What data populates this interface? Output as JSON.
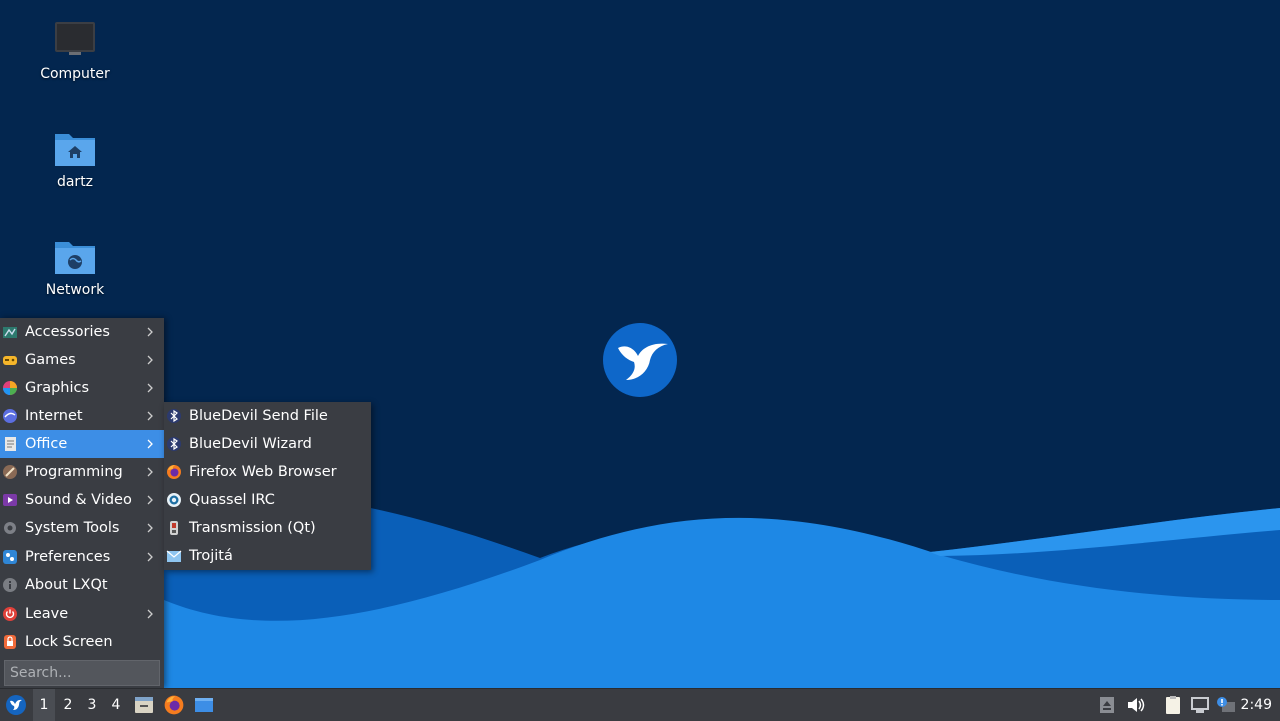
{
  "desktop": {
    "icons": [
      {
        "label": "Computer",
        "icon": "computer-icon"
      },
      {
        "label": "dartz",
        "icon": "home-folder-icon"
      },
      {
        "label": "Network",
        "icon": "network-folder-icon"
      }
    ],
    "wallpaper_colors": {
      "background": "#03264f",
      "wave_dark": "#0a5fb8",
      "wave_light": "#1e88e5"
    }
  },
  "main_menu": {
    "items": [
      {
        "label": "Accessories",
        "icon": "accessories-icon",
        "has_submenu": true
      },
      {
        "label": "Games",
        "icon": "games-icon",
        "has_submenu": true
      },
      {
        "label": "Graphics",
        "icon": "graphics-icon",
        "has_submenu": true
      },
      {
        "label": "Internet",
        "icon": "internet-icon",
        "has_submenu": true
      },
      {
        "label": "Office",
        "icon": "office-icon",
        "has_submenu": true,
        "active": true
      },
      {
        "label": "Programming",
        "icon": "programming-icon",
        "has_submenu": true
      },
      {
        "label": "Sound & Video",
        "icon": "sound-video-icon",
        "has_submenu": true
      },
      {
        "label": "System Tools",
        "icon": "system-tools-icon",
        "has_submenu": true
      },
      {
        "label": "Preferences",
        "icon": "preferences-icon",
        "has_submenu": true
      },
      {
        "label": "About LXQt",
        "icon": "info-icon",
        "has_submenu": false
      },
      {
        "label": "Leave",
        "icon": "power-icon",
        "has_submenu": true
      },
      {
        "label": "Lock Screen",
        "icon": "lock-icon",
        "has_submenu": false
      }
    ],
    "search_placeholder": "Search..."
  },
  "submenu": {
    "items": [
      {
        "label": "BlueDevil Send File",
        "icon": "bluetooth-icon"
      },
      {
        "label": "BlueDevil Wizard",
        "icon": "bluetooth-icon"
      },
      {
        "label": "Firefox Web Browser",
        "icon": "firefox-icon"
      },
      {
        "label": "Quassel IRC",
        "icon": "quassel-icon"
      },
      {
        "label": "Transmission (Qt)",
        "icon": "transmission-icon"
      },
      {
        "label": "Trojitá",
        "icon": "mail-icon"
      }
    ]
  },
  "taskbar": {
    "desktops": [
      "1",
      "2",
      "3",
      "4"
    ],
    "current_desktop": "1",
    "launchers": [
      "file-manager-icon",
      "firefox-icon",
      "show-desktop-icon"
    ],
    "tray": [
      "eject-icon",
      "volume-icon",
      "clipboard-icon",
      "network-tray-icon",
      "update-notifier-icon"
    ],
    "clock": "2:49"
  },
  "colors": {
    "accent": "#3d8ee6",
    "menu_bg": "#3a3d43",
    "taskbar_bg": "#3a3c41"
  }
}
